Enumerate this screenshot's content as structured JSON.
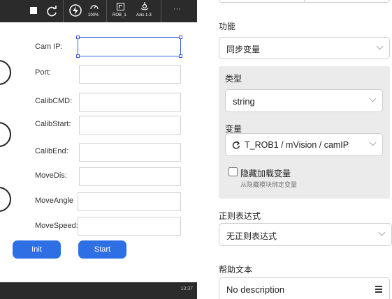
{
  "left_panel": {
    "topbar": {
      "zoom_label": "100%",
      "robot_label": "ROB_1",
      "axis_label": "Axis 1-3",
      "more_label": "···"
    },
    "fields": [
      {
        "label": "Cam IP:"
      },
      {
        "label": "Port:"
      },
      {
        "label": "CalibCMD:"
      },
      {
        "label": "CalibStart:"
      },
      {
        "label": "CalibEnd:"
      },
      {
        "label": "MoveDis:"
      },
      {
        "label": "MoveAngle"
      },
      {
        "label": "MoveSpeed:"
      }
    ],
    "buttons": {
      "init": "Init",
      "start": "Start"
    },
    "clock": "13:37"
  },
  "right_panel": {
    "function": {
      "title": "功能",
      "value": "同步变量"
    },
    "type": {
      "title": "类型",
      "value": "string"
    },
    "variable": {
      "title": "变量",
      "value": "T_ROB1 / mVision / camIP"
    },
    "hide_load": {
      "label": "隐藏加载变量",
      "sub_label": "从隐藏模块绑定变量"
    },
    "regex": {
      "title": "正则表达式",
      "value": "无正则表达式"
    },
    "help": {
      "title": "帮助文本",
      "value": "No description"
    }
  },
  "colors": {
    "accent": "#2f6fe4",
    "selection": "#3b5bdb",
    "topbar": "#2b2b2b",
    "panel_gray": "#ebebeb"
  },
  "icons": [
    "stop-icon",
    "refresh-icon",
    "lightning-icon",
    "speed-gauge-icon",
    "robot-icon",
    "axis-icon",
    "more-icon",
    "chevron-down-icon",
    "menu-icon",
    "reload-icon",
    "checkbox-icon"
  ]
}
